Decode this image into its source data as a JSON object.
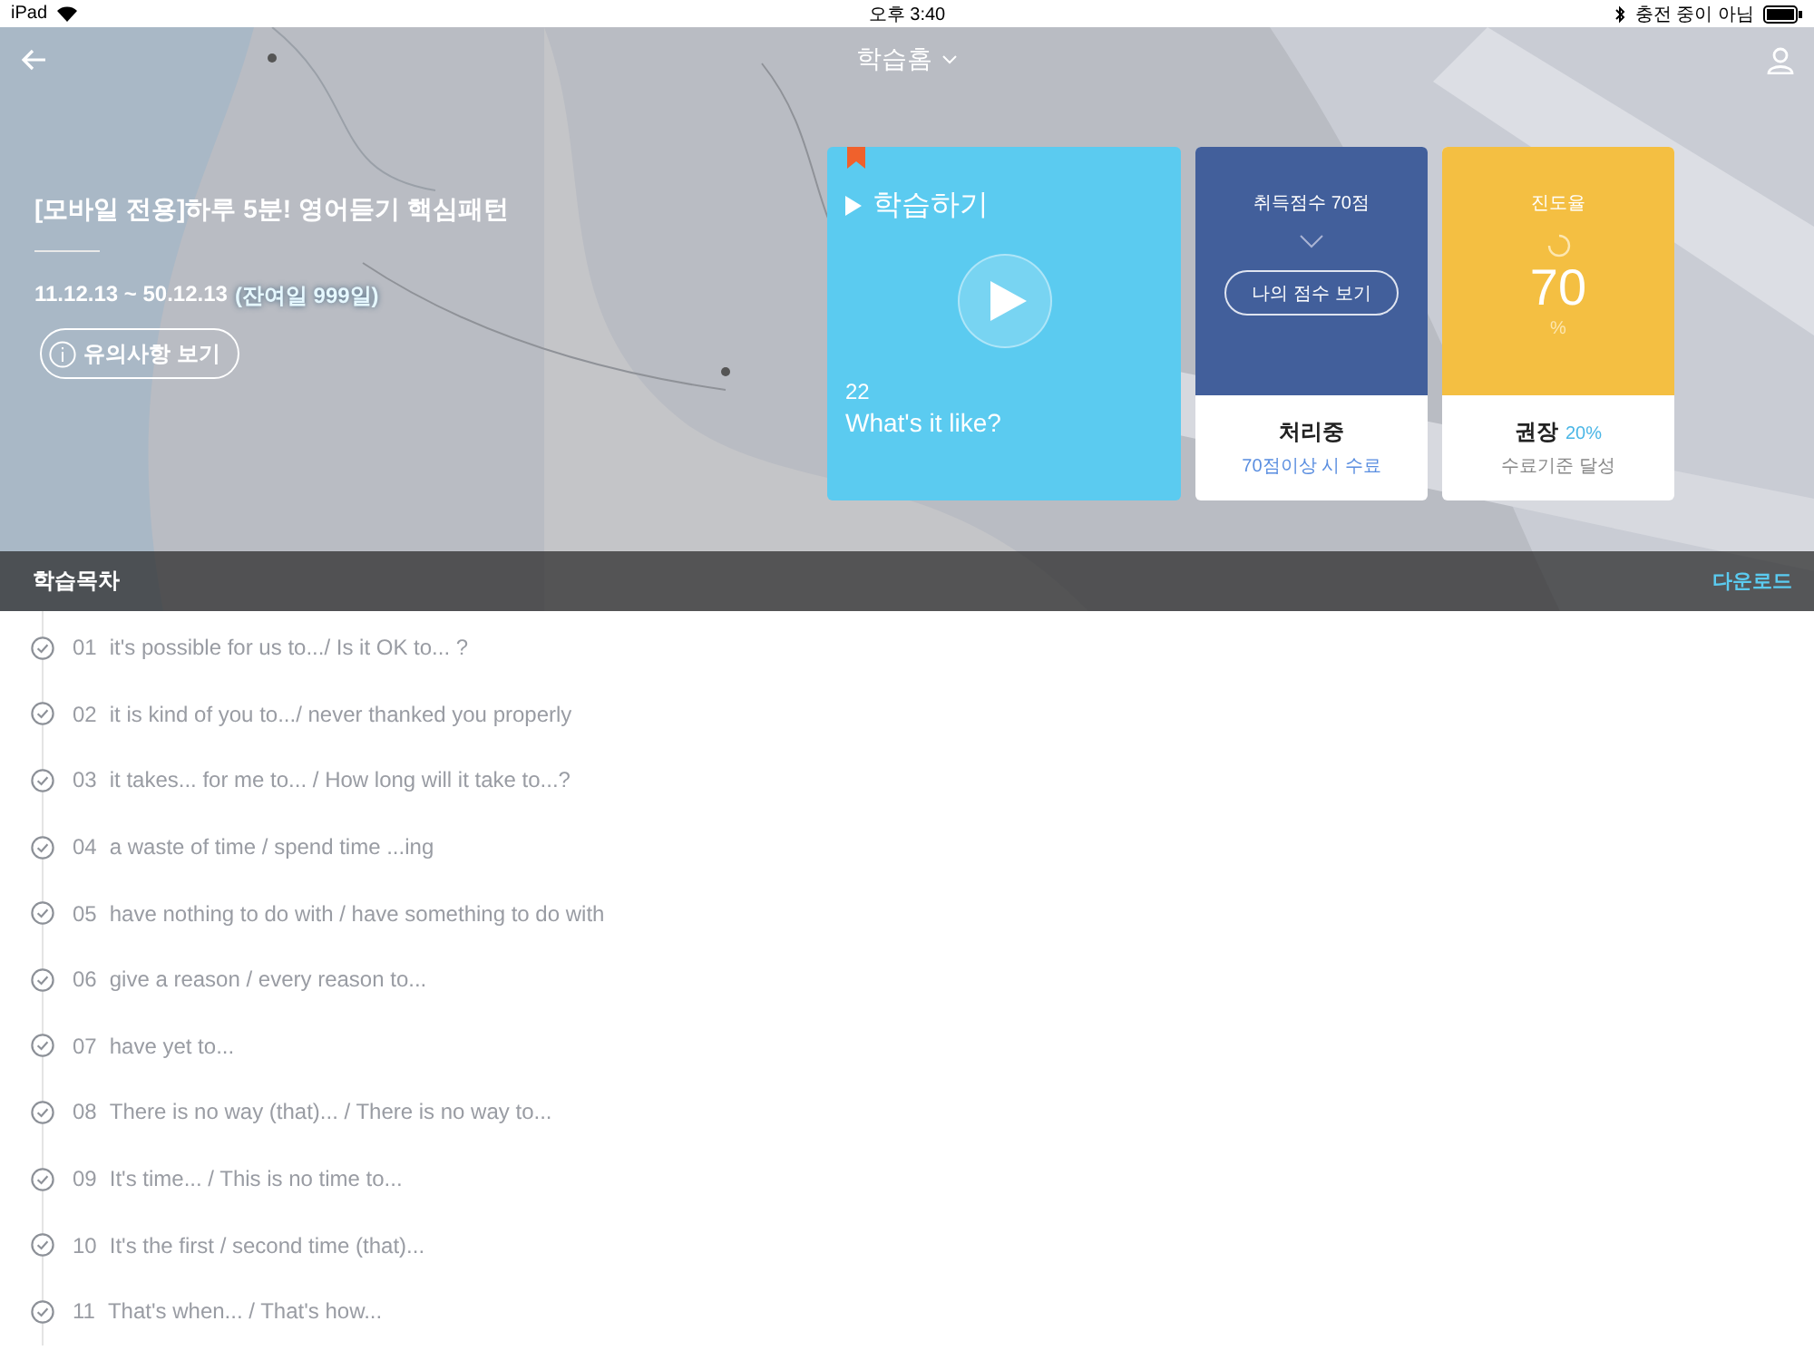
{
  "status_bar": {
    "device": "iPad",
    "time": "오후 3:40",
    "battery_text": "충전 중이 아님"
  },
  "nav": {
    "title": "학습홈"
  },
  "course": {
    "title": "[모바일 전용]하루 5분! 영어듣기 핵심패턴",
    "period": "11.12.13 ~ 50.12.13",
    "remaining": "(잔여일 999일)",
    "notice_button": "유의사항 보기"
  },
  "learn_card": {
    "label": "학습하기",
    "number": "22",
    "lesson": "What's it like?"
  },
  "score_card": {
    "title": "취득점수 70점",
    "button": "나의 점수 보기",
    "status": "처리중",
    "note": "70점이상 시 수료"
  },
  "progress_card": {
    "title": "진도율",
    "value": "70",
    "unit": "%",
    "recommend_label": "권장",
    "recommend_value": "20%",
    "note": "수료기준 달성"
  },
  "section": {
    "title": "학습목차",
    "action": "다운로드"
  },
  "lessons": [
    {
      "number": "01",
      "title": "it's possible for us to.../ Is it OK to... ?"
    },
    {
      "number": "02",
      "title": "it is kind of you to.../ never thanked you properly"
    },
    {
      "number": "03",
      "title": "it takes... for me to... / How long will it take to...?"
    },
    {
      "number": "04",
      "title": "a waste of time / spend time ...ing"
    },
    {
      "number": "05",
      "title": "have nothing to do with / have something to do with"
    },
    {
      "number": "06",
      "title": "give a reason / every reason to..."
    },
    {
      "number": "07",
      "title": "have yet to..."
    },
    {
      "number": "08",
      "title": "There is no way (that)... / There is no way to..."
    },
    {
      "number": "09",
      "title": "It's time... / This is no time to..."
    },
    {
      "number": "10",
      "title": "It's the first / second time (that)..."
    },
    {
      "number": "11",
      "title": "That's when... / That's how..."
    }
  ]
}
